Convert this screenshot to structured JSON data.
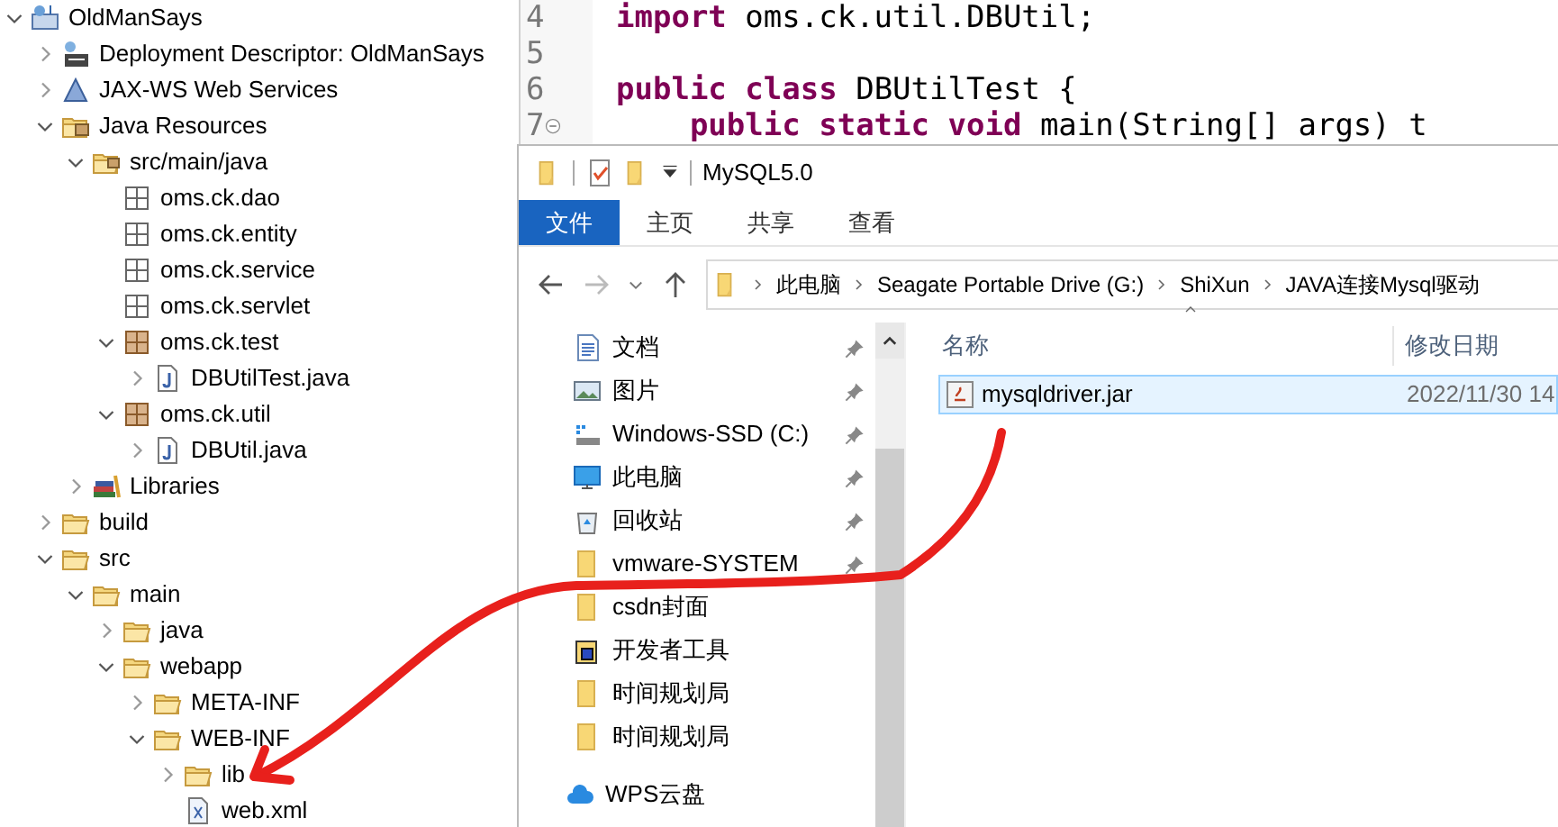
{
  "project_tree": [
    {
      "label": "OldManSays",
      "kind": "project",
      "expanded": true,
      "children": [
        {
          "label": "Deployment Descriptor: OldManSays",
          "kind": "descriptor",
          "expanded": false
        },
        {
          "label": "JAX-WS Web Services",
          "kind": "webservices",
          "expanded": false
        },
        {
          "label": "Java Resources",
          "kind": "resources",
          "expanded": true,
          "children": [
            {
              "label": "src/main/java",
              "kind": "srcfolder",
              "expanded": true,
              "children": [
                {
                  "label": "oms.ck.dao",
                  "kind": "package"
                },
                {
                  "label": "oms.ck.entity",
                  "kind": "package"
                },
                {
                  "label": "oms.ck.service",
                  "kind": "package"
                },
                {
                  "label": "oms.ck.servlet",
                  "kind": "package"
                },
                {
                  "label": "oms.ck.test",
                  "kind": "package_full",
                  "expanded": true,
                  "children": [
                    {
                      "label": "DBUtilTest.java",
                      "kind": "java",
                      "expanded": false
                    }
                  ]
                },
                {
                  "label": "oms.ck.util",
                  "kind": "package_full",
                  "expanded": true,
                  "children": [
                    {
                      "label": "DBUtil.java",
                      "kind": "java",
                      "expanded": false
                    }
                  ]
                }
              ]
            },
            {
              "label": "Libraries",
              "kind": "libraries",
              "expanded": false
            }
          ]
        },
        {
          "label": "build",
          "kind": "folder",
          "expanded": false
        },
        {
          "label": "src",
          "kind": "folder",
          "expanded": true,
          "children": [
            {
              "label": "main",
              "kind": "folder",
              "expanded": true,
              "children": [
                {
                  "label": "java",
                  "kind": "folder",
                  "expanded": false
                },
                {
                  "label": "webapp",
                  "kind": "folder",
                  "expanded": true,
                  "children": [
                    {
                      "label": "META-INF",
                      "kind": "folder",
                      "expanded": false
                    },
                    {
                      "label": "WEB-INF",
                      "kind": "folder",
                      "expanded": true,
                      "children": [
                        {
                          "label": "lib",
                          "kind": "folder",
                          "expanded": false
                        },
                        {
                          "label": "web.xml",
                          "kind": "xml"
                        }
                      ]
                    }
                  ]
                }
              ]
            }
          ]
        }
      ]
    }
  ],
  "editor": {
    "lines": [
      {
        "number": "4",
        "tokens": [
          {
            "text": "import",
            "kind": "keyword"
          },
          {
            "text": " oms.ck.util.DBUtil;",
            "kind": "plain"
          }
        ]
      },
      {
        "number": "5"
      },
      {
        "number": "6",
        "tokens": [
          {
            "text": "public",
            "kind": "keyword"
          },
          {
            "text": " class",
            "kind": "keyword"
          },
          {
            "text": " DBUtilTest {",
            "kind": "plain"
          }
        ]
      },
      {
        "number": "7",
        "fold": true,
        "tokens": [
          {
            "text": "    public",
            "kind": "keyword"
          },
          {
            "text": " static",
            "kind": "keyword"
          },
          {
            "text": " void",
            "kind": "keyword"
          },
          {
            "text": " main(String[] args) t",
            "kind": "plain"
          }
        ]
      }
    ]
  },
  "explorer": {
    "title": "MySQL5.0",
    "ribbon_tabs": [
      {
        "label": "文件",
        "selected": true
      },
      {
        "label": "主页",
        "selected": false
      },
      {
        "label": "共享",
        "selected": false
      },
      {
        "label": "查看",
        "selected": false
      }
    ],
    "breadcrumb": [
      "此电脑",
      "Seagate Portable Drive (G:)",
      "ShiXun",
      "JAVA连接Mysql驱动"
    ],
    "nav_items": [
      {
        "label": "文档",
        "kind": "documents",
        "pinned": true
      },
      {
        "label": "图片",
        "kind": "pictures",
        "pinned": true
      },
      {
        "label": "Windows-SSD (C:)",
        "kind": "drive",
        "pinned": true
      },
      {
        "label": "此电脑",
        "kind": "pc",
        "pinned": true
      },
      {
        "label": "回收站",
        "kind": "recycle",
        "pinned": true
      },
      {
        "label": "vmware-SYSTEM",
        "kind": "folder",
        "pinned": true
      },
      {
        "label": "csdn封面",
        "kind": "folder",
        "pinned": false
      },
      {
        "label": "开发者工具",
        "kind": "devfolder",
        "pinned": false
      },
      {
        "label": "时间规划局",
        "kind": "folder",
        "pinned": false
      },
      {
        "label": "时间规划局",
        "kind": "folder",
        "pinned": false
      },
      {
        "label": "WPS云盘",
        "kind": "cloud",
        "pinned": false
      }
    ],
    "columns": [
      "名称",
      "修改日期"
    ],
    "files": [
      {
        "name": "mysqldriver.jar",
        "modified": "2022/11/30 14",
        "hovered": true
      }
    ]
  }
}
